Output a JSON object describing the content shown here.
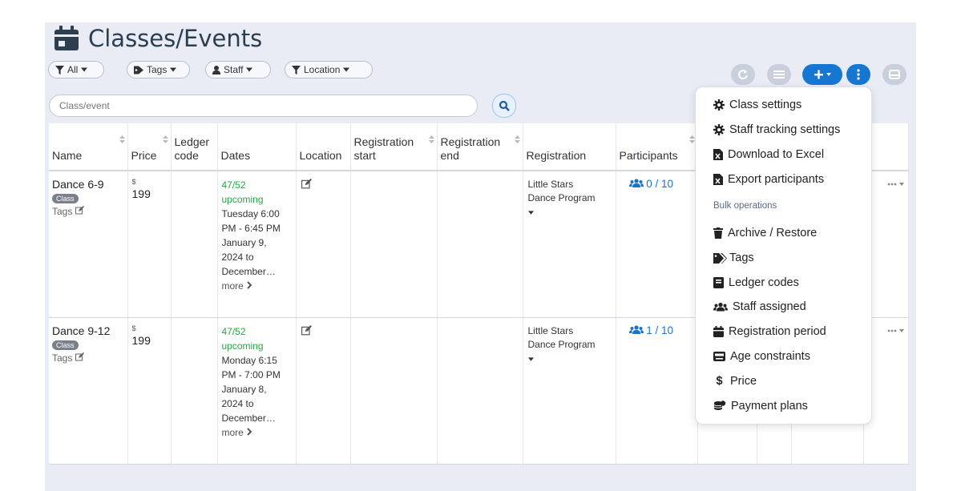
{
  "page": {
    "title": "Classes/Events"
  },
  "filters": {
    "all": "All",
    "tags": "Tags",
    "staff": "Staff",
    "location": "Location"
  },
  "search": {
    "placeholder": "Class/event"
  },
  "table": {
    "headers": {
      "name": "Name",
      "price": "Price",
      "ledger": [
        "Ledger",
        "code"
      ],
      "dates": "Dates",
      "location": "Location",
      "reg_start": [
        "Registration",
        "start"
      ],
      "reg_end": [
        "Registration",
        "end"
      ],
      "registration": "Registration",
      "participants": "Participants"
    },
    "rows": [
      {
        "name": "Dance 6-9",
        "badge": "Class",
        "tags": "Tags",
        "currency": "$",
        "price": "199",
        "dates_count": "47/52",
        "dates_status": "upcoming",
        "schedule": [
          "Tuesday 6:00",
          "PM - 6:45 PM",
          "January 9,",
          "2024 to",
          "December…"
        ],
        "more": "more",
        "registration": [
          "Little Stars",
          "Dance Program"
        ],
        "participants": "0 / 10"
      },
      {
        "name": "Dance 9-12",
        "badge": "Class",
        "tags": "Tags",
        "currency": "$",
        "price": "199",
        "dates_count": "47/52",
        "dates_status": "upcoming",
        "schedule": [
          "Monday 6:15",
          "PM - 7:00 PM",
          "January 8,",
          "2024 to",
          "December…"
        ],
        "more": "more",
        "registration": [
          "Little Stars",
          "Dance Program"
        ],
        "participants": "1 / 10"
      }
    ]
  },
  "menu": {
    "class_settings": "Class settings",
    "staff_tracking": "Staff tracking settings",
    "download_excel": "Download to Excel",
    "export_participants": "Export participants",
    "bulk_header": "Bulk operations",
    "archive": "Archive / Restore",
    "tags": "Tags",
    "ledger_codes": "Ledger codes",
    "staff_assigned": "Staff assigned",
    "registration_period": "Registration period",
    "age_constraints": "Age constraints",
    "price": "Price",
    "payment_plans": "Payment plans"
  },
  "colors": {
    "accent": "#1677d2",
    "success": "#28a745",
    "panel": "#e9ecf5",
    "title": "#2c3e50"
  }
}
